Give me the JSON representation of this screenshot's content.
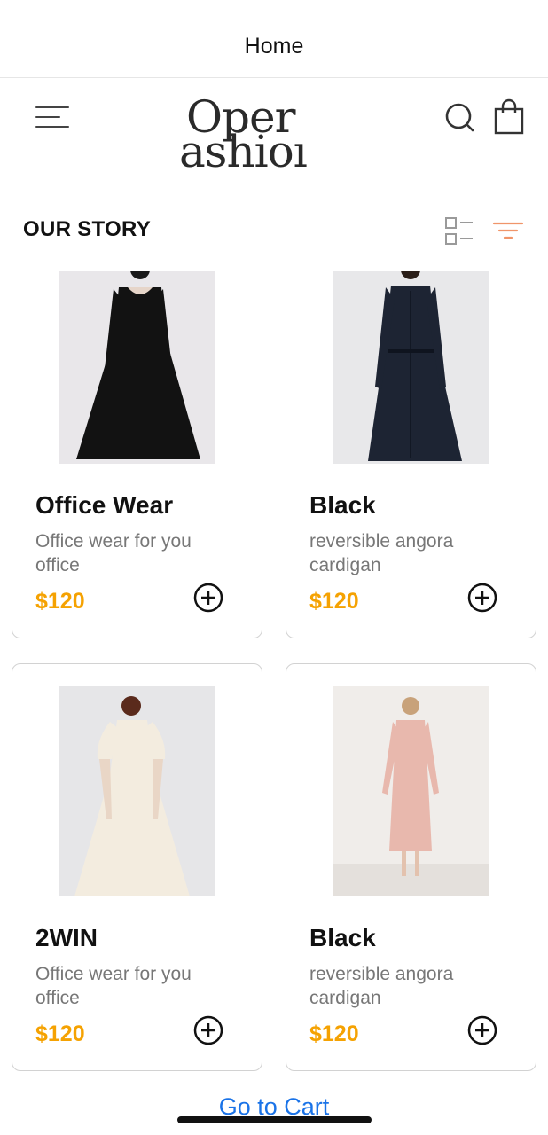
{
  "nav": {
    "title": "Home"
  },
  "header": {
    "logo_line1": "Oper",
    "logo_line2": "ashioı",
    "icons": [
      "hamburger-menu-icon",
      "search-icon",
      "shopping-bag-icon"
    ]
  },
  "section": {
    "title": "OUR STORY",
    "icons": [
      "grid-list-toggle-icon",
      "filter-icon"
    ],
    "filter_color": "#f0956a"
  },
  "products": [
    {
      "name": "Office Wear",
      "description": "Office wear for you office",
      "price": "$120",
      "add_icon": "plus-circle-icon"
    },
    {
      "name": "Black",
      "description": "reversible angora cardigan",
      "price": "$120",
      "add_icon": "plus-circle-icon"
    },
    {
      "name": "2WIN",
      "description": "Office wear for you office",
      "price": "$120",
      "add_icon": "plus-circle-icon"
    },
    {
      "name": "Black",
      "description": "reversible angora cardigan",
      "price": "$120",
      "add_icon": "plus-circle-icon"
    }
  ],
  "colors": {
    "price": "#f5a202",
    "link": "#1a73e8"
  },
  "footer": {
    "cart_link": "Go to Cart"
  }
}
